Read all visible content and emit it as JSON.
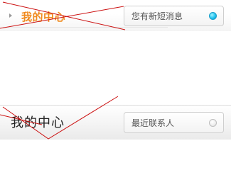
{
  "header_primary": {
    "title": "我的中心",
    "button_label": "您有新短消息",
    "indicator": "active",
    "accent_color": "#f08a1e",
    "indicator_color": "#22c4f0"
  },
  "header_secondary": {
    "title": "我的中心",
    "button_label": "最近联系人",
    "indicator": "inactive"
  }
}
